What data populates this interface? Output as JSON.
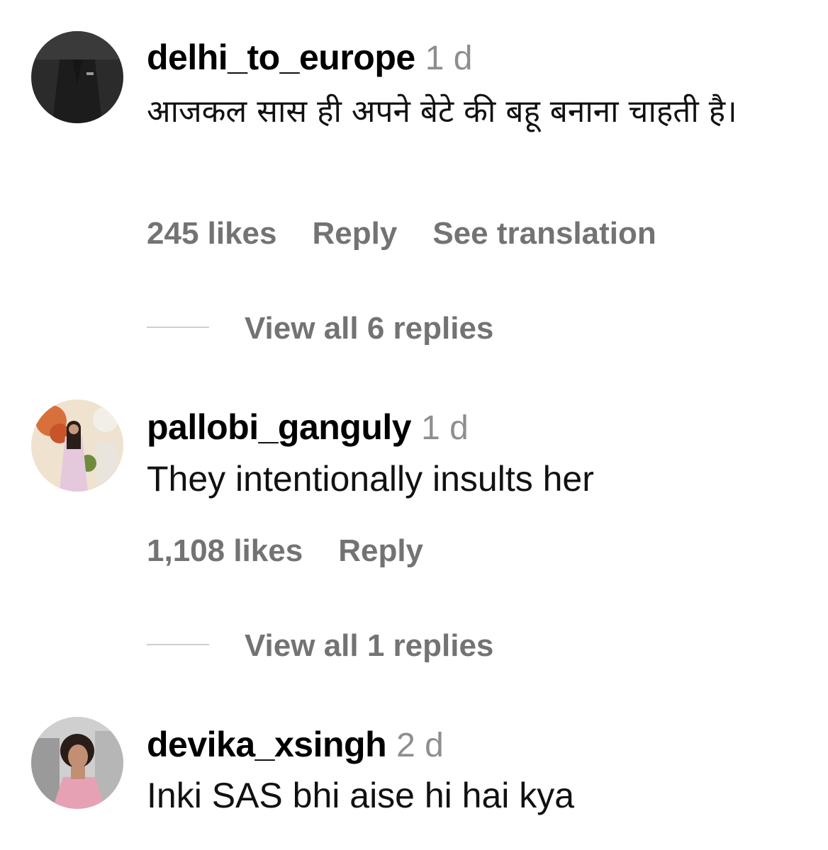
{
  "comments": [
    {
      "username": "delhi_to_europe",
      "time": "1 d",
      "text": "आजकल सास ही अपने बेटे की बहू बनाना चाहती है।",
      "likes": "245 likes",
      "reply": "Reply",
      "translate": "See translation",
      "view_replies": "View all 6 replies"
    },
    {
      "username": "pallobi_ganguly",
      "time": "1 d",
      "text": "They intentionally insults her",
      "likes": "1,108 likes",
      "reply": "Reply",
      "view_replies": "View all 1 replies"
    },
    {
      "username": "devika_xsingh",
      "time": "2 d",
      "text": "Inki SAS bhi aise hi hai kya"
    }
  ],
  "colors": {
    "muted_text": "#737373",
    "timestamp": "#8e8e8e",
    "divider": "#cfcfcf"
  }
}
